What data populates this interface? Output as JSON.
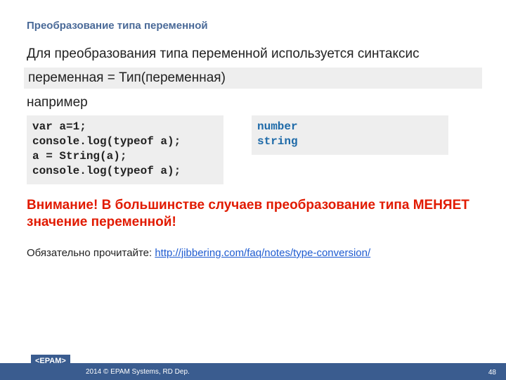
{
  "title": "Преобразование типа переменной",
  "intro": "Для преобразования типа переменной используется синтаксис",
  "syntax": "переменная = Тип(переменная)",
  "example_label": "например",
  "code_left": "var a=1;\nconsole.log(typeof a);\na = String(a);\nconsole.log(typeof a);",
  "code_right": "number\nstring",
  "warning": "Внимание! В большинстве случаев преобразование типа МЕНЯЕТ значение переменной!",
  "note_prefix": "Обязательно прочитайте: ",
  "note_link_text": "http://jibbering.com/faq/notes/type-conversion/",
  "note_link_href": "http://jibbering.com/faq/notes/type-conversion/",
  "logo": "<EPAM>",
  "footer_text": "2014 © EPAM Systems, RD Dep.",
  "page_number": "48"
}
